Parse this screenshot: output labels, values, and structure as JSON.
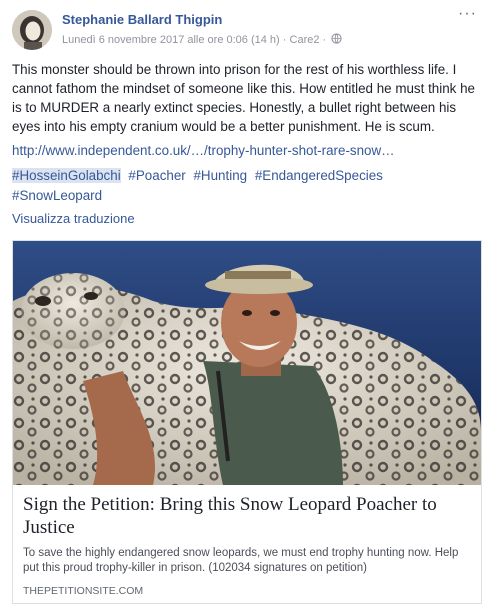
{
  "post": {
    "author": "Stephanie Ballard Thigpin",
    "timestamp": "Lunedì 6 novembre 2017 alle ore 0:06 (14 h)",
    "separator": "·",
    "group": "Care2",
    "privacy_icon": "globe-icon",
    "more_label": "···",
    "body": "This monster should be thrown into prison for the rest of his worthless life. I cannot fathom the mindset of someone like this. How entitled he must think he is to MURDER a nearly extinct species. Honestly, a bullet right between his eyes into his empty cranium would be a better punishment. He is scum.",
    "link_text": "http://www.independent.co.uk/…/trophy-hunter-shot-rare-snow…",
    "hashtags": [
      "#HosseinGolabchi",
      "#Poacher",
      "#Hunting",
      "#EndangeredSpecies",
      "#SnowLeopard"
    ],
    "translate_label": "Visualizza traduzione"
  },
  "card": {
    "title": "Sign the Petition: Bring this Snow Leopard Poacher to Justice",
    "description": "To save the highly endangered snow leopards, we must end trophy hunting now. Help put this proud trophy-killer in prison. (102034 signatures on petition)",
    "domain": "THEPETITIONSITE.COM"
  },
  "colors": {
    "link": "#365899",
    "text": "#1d2129",
    "meta": "#90949c"
  }
}
